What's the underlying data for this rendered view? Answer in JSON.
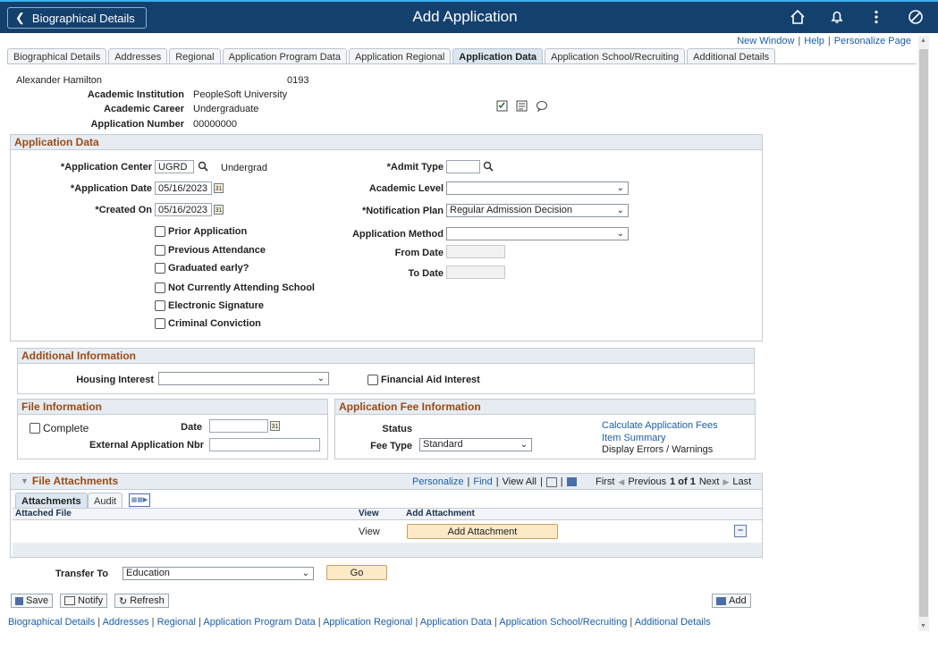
{
  "topbar": {
    "back_label": "Biographical Details",
    "title": "Add Application"
  },
  "toplinks": [
    "New Window",
    "Help",
    "Personalize Page"
  ],
  "tabs": [
    "Biographical Details",
    "Addresses",
    "Regional",
    "Application Program Data",
    "Application Regional",
    "Application Data",
    "Application School/Recruiting",
    "Additional Details"
  ],
  "active_tab": "Application Data",
  "header": {
    "name": "Alexander Hamilton",
    "id": "0193",
    "inst_label": "Academic Institution",
    "inst_value": "PeopleSoft University",
    "career_label": "Academic Career",
    "career_value": "Undergraduate",
    "appnum_label": "Application Number",
    "appnum_value": "00000000"
  },
  "app_data": {
    "title": "Application Data",
    "center_label": "*Application Center",
    "center_value": "UGRD",
    "center_desc": "Undergrad",
    "date_label": "*Application Date",
    "date_value": "05/16/2023",
    "created_label": "*Created On",
    "created_value": "05/16/2023",
    "checkboxes": [
      "Prior Application",
      "Previous Attendance",
      "Graduated early?",
      "Not Currently Attending School",
      "Electronic Signature",
      "Criminal Conviction"
    ],
    "admit_label": "*Admit Type",
    "admit_value": "",
    "level_label": "Academic Level",
    "level_value": "",
    "notif_label": "*Notification Plan",
    "notif_value": "Regular Admission Decision",
    "method_label": "Application Method",
    "method_value": "",
    "from_label": "From Date",
    "to_label": "To Date"
  },
  "additional": {
    "title": "Additional Information",
    "housing_label": "Housing Interest",
    "housing_value": "",
    "finaid_label": "Financial Aid Interest"
  },
  "file_info": {
    "title": "File Information",
    "complete_label": "Complete",
    "date_label": "Date",
    "ext_label": "External Application Nbr"
  },
  "fee_info": {
    "title": "Application Fee Information",
    "status_label": "Status",
    "fee_type_label": "Fee Type",
    "fee_type_value": "Standard",
    "calc_link": "Calculate Application Fees",
    "summary_link": "Item Summary",
    "errors_text": "Display Errors / Warnings"
  },
  "attachments": {
    "title": "File Attachments",
    "personalize": "Personalize",
    "find": "Find",
    "view_all": "View All",
    "first": "First",
    "previous": "Previous",
    "page": "1 of 1",
    "next": "Next",
    "last": "Last",
    "tab_attachments": "Attachments",
    "tab_audit": "Audit",
    "col_file": "Attached File",
    "col_view": "View",
    "col_add": "Add Attachment",
    "row_view": "View",
    "add_button": "Add Attachment"
  },
  "transfer": {
    "label": "Transfer To",
    "value": "Education",
    "go": "Go"
  },
  "toolbar": {
    "save": "Save",
    "notify": "Notify",
    "refresh": "Refresh",
    "add": "Add"
  },
  "footer_links": [
    "Biographical Details",
    "Addresses",
    "Regional",
    "Application Program Data",
    "Application Regional",
    "Application Data",
    "Application School/Recruiting",
    "Additional Details"
  ]
}
